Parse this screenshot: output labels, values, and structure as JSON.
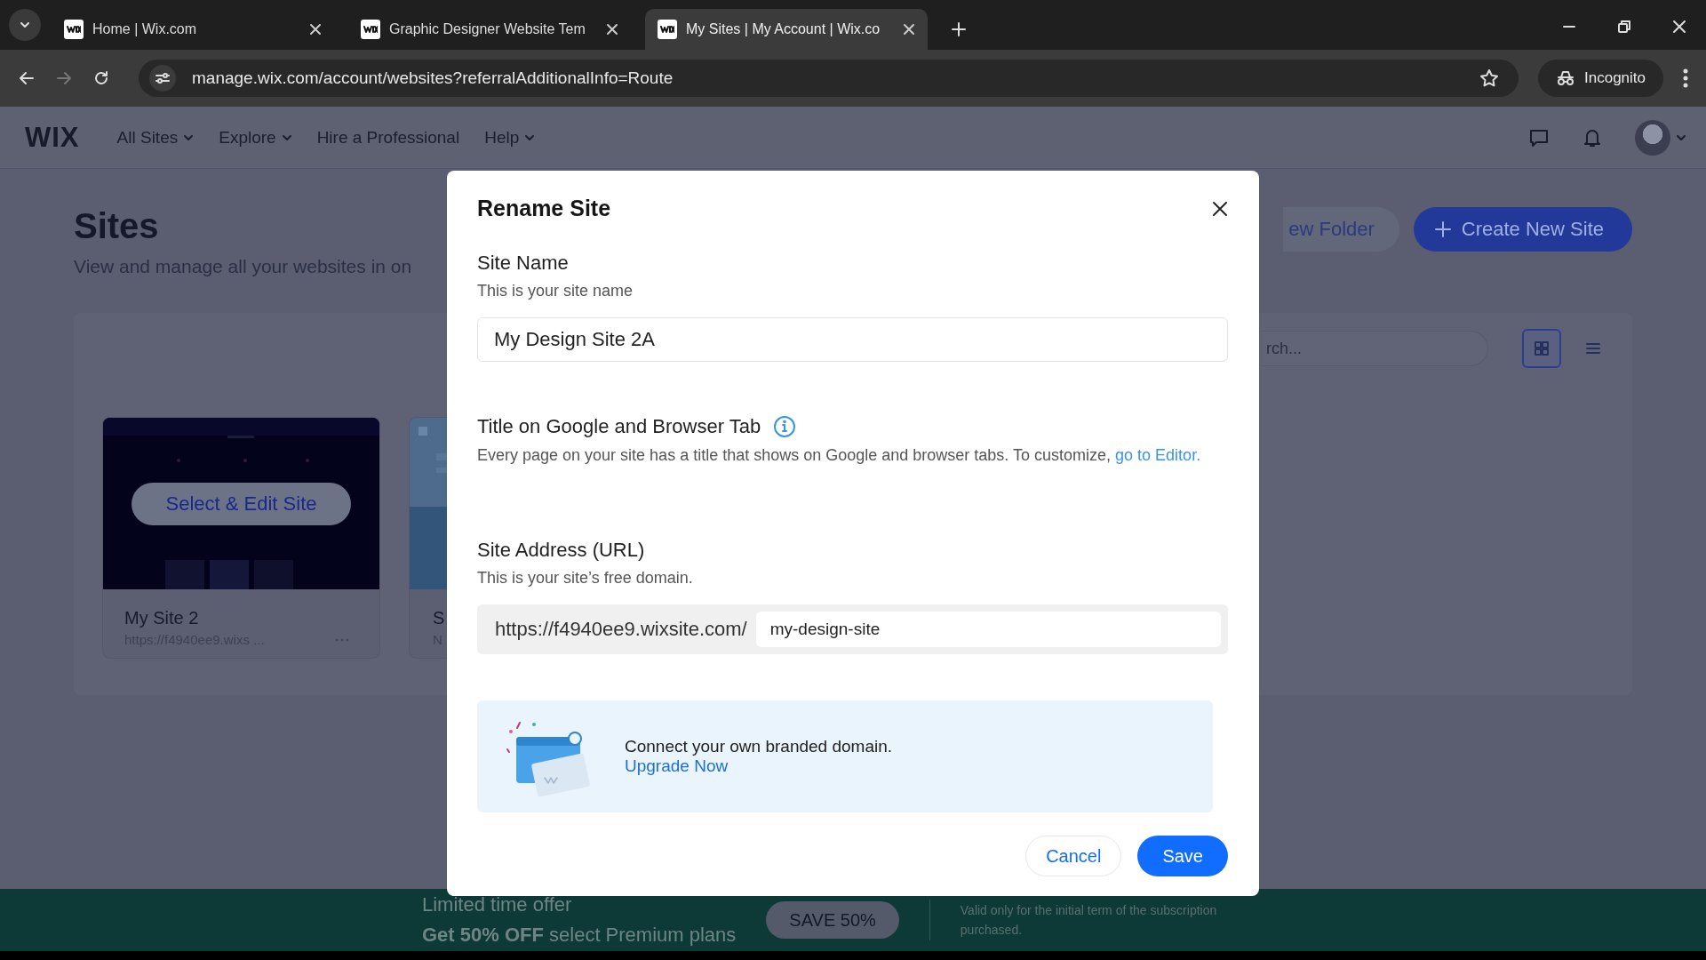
{
  "browser": {
    "tabs": [
      {
        "title": "Home | Wix.com",
        "selected": false
      },
      {
        "title": "Graphic Designer Website Tem",
        "selected": false
      },
      {
        "title": "My Sites | My Account | Wix.co",
        "selected": true
      }
    ],
    "address": "manage.wix.com/account/websites?referralAdditionalInfo=Route",
    "incognito_label": "Incognito"
  },
  "header": {
    "logo": "WIX",
    "nav": [
      {
        "label": "All Sites",
        "dropdown": true
      },
      {
        "label": "Explore",
        "dropdown": true
      },
      {
        "label": "Hire a Professional",
        "dropdown": false
      },
      {
        "label": "Help",
        "dropdown": true
      }
    ]
  },
  "page": {
    "title": "Sites",
    "subtitle": "View and manage all your websites in on",
    "folder_button": "ew Folder",
    "create_button": "Create New Site",
    "search": {
      "placeholder": "rch..."
    },
    "views": [
      {
        "kind": "grid",
        "selected": true
      },
      {
        "kind": "list",
        "selected": false
      }
    ],
    "cards": [
      {
        "name": "My Site 2",
        "url": "https://f4940ee9.wixs ...",
        "action": "Select & Edit Site",
        "kind": "dark"
      },
      {
        "name": "S",
        "url": "N",
        "kind": "light"
      }
    ]
  },
  "dialog": {
    "title": "Rename Site",
    "site_name": {
      "label": "Site Name",
      "hint": "This is your site name",
      "value": "My Design Site 2A"
    },
    "title_section": {
      "label": "Title on Google and Browser Tab",
      "text": "Every page on your site has a title that shows on Google and browser tabs. To customize, ",
      "link": "go to Editor."
    },
    "address": {
      "label": "Site Address (URL)",
      "hint": "This is your site’s free domain.",
      "prefix": "https://f4940ee9.wixsite.com/",
      "value": "my-design-site"
    },
    "promo": {
      "text": "Connect your own branded domain.",
      "link": "Upgrade Now"
    },
    "buttons": {
      "cancel": "Cancel",
      "save": "Save"
    }
  },
  "banner": {
    "line1": "Limited time offer",
    "line2": "**Get 50% OFF** select Premium plans",
    "button": "SAVE 50%",
    "note": "Valid only for the initial term of the subscription purchased."
  }
}
